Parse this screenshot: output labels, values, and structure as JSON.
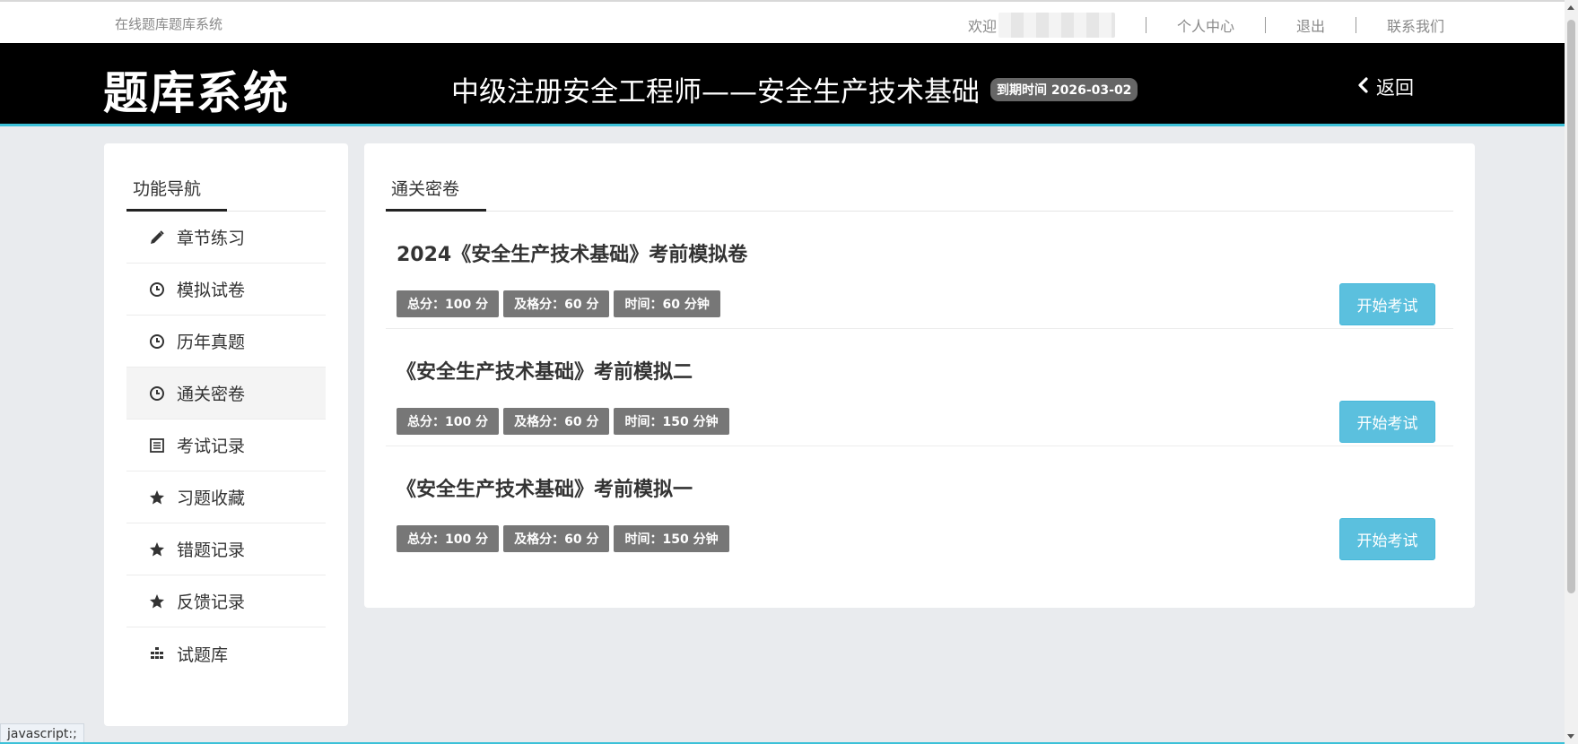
{
  "topbar": {
    "site_name": "在线题库题库系统",
    "welcome": "欢迎",
    "links": [
      "个人中心",
      "退出",
      "联系我们"
    ]
  },
  "header": {
    "logo": "题库系统",
    "course_title": "中级注册安全工程师——安全生产技术基础",
    "expiry": "到期时间 2026-03-02",
    "back_label": "返回"
  },
  "sidebar": {
    "title": "功能导航",
    "items": [
      {
        "label": "章节练习",
        "icon": "pencil-icon"
      },
      {
        "label": "模拟试卷",
        "icon": "clock-icon"
      },
      {
        "label": "历年真题",
        "icon": "clock-icon"
      },
      {
        "label": "通关密卷",
        "icon": "clock-icon",
        "active": true
      },
      {
        "label": "考试记录",
        "icon": "list-alt-icon"
      },
      {
        "label": "习题收藏",
        "icon": "star-icon"
      },
      {
        "label": "错题记录",
        "icon": "star-icon"
      },
      {
        "label": "反馈记录",
        "icon": "star-icon"
      },
      {
        "label": "试题库",
        "icon": "tasks-icon"
      }
    ]
  },
  "main": {
    "tab_label": "通关密卷",
    "papers": [
      {
        "title": "2024《安全生产技术基础》考前模拟卷",
        "total": "总分：100 分",
        "pass": "及格分：60 分",
        "time": "时间：60 分钟",
        "button": "开始考试"
      },
      {
        "title": "《安全生产技术基础》考前模拟二",
        "total": "总分：100 分",
        "pass": "及格分：60 分",
        "time": "时间：150 分钟",
        "button": "开始考试"
      },
      {
        "title": "《安全生产技术基础》考前模拟一",
        "total": "总分：100 分",
        "pass": "及格分：60 分",
        "time": "时间：150 分钟",
        "button": "开始考试"
      }
    ]
  },
  "status_bar": {
    "text": "javascript:;"
  },
  "colors": {
    "header_bg": "#000000",
    "accent": "#3cc1d8",
    "button": "#5bc0de",
    "tag": "#777777",
    "page_bg": "#e9ebee"
  }
}
